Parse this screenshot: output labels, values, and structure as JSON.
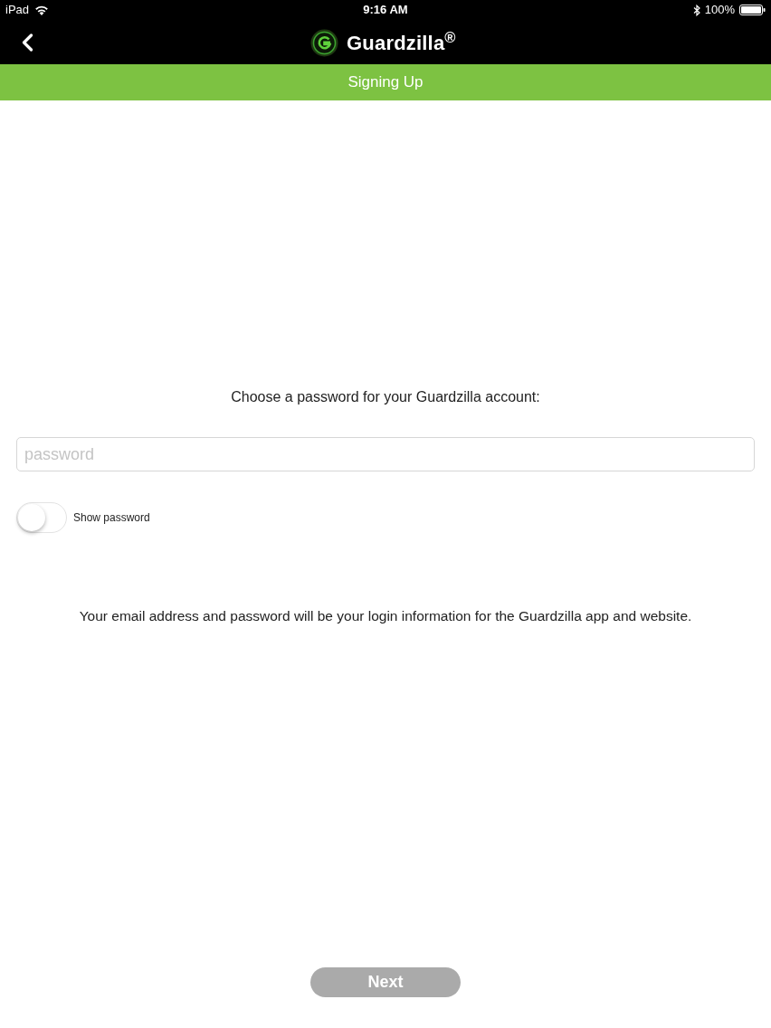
{
  "status_bar": {
    "device": "iPad",
    "time": "9:16 AM",
    "battery": "100%"
  },
  "nav_bar": {
    "logo_text": "Guardzilla$^{®}$"
  },
  "banner": {
    "title": "Signing Up"
  },
  "form": {
    "prompt": "Choose a password for your Guardzilla account:",
    "password_field": {
      "placeholder": "password"
    },
    "show_password": {
      "label": "Show password",
      "on": false
    },
    "note": "Your email address and password will be your login information for the Guardzilla app and website."
  },
  "next_button": {
    "label": "Next",
    "disabled": true
  }
}
